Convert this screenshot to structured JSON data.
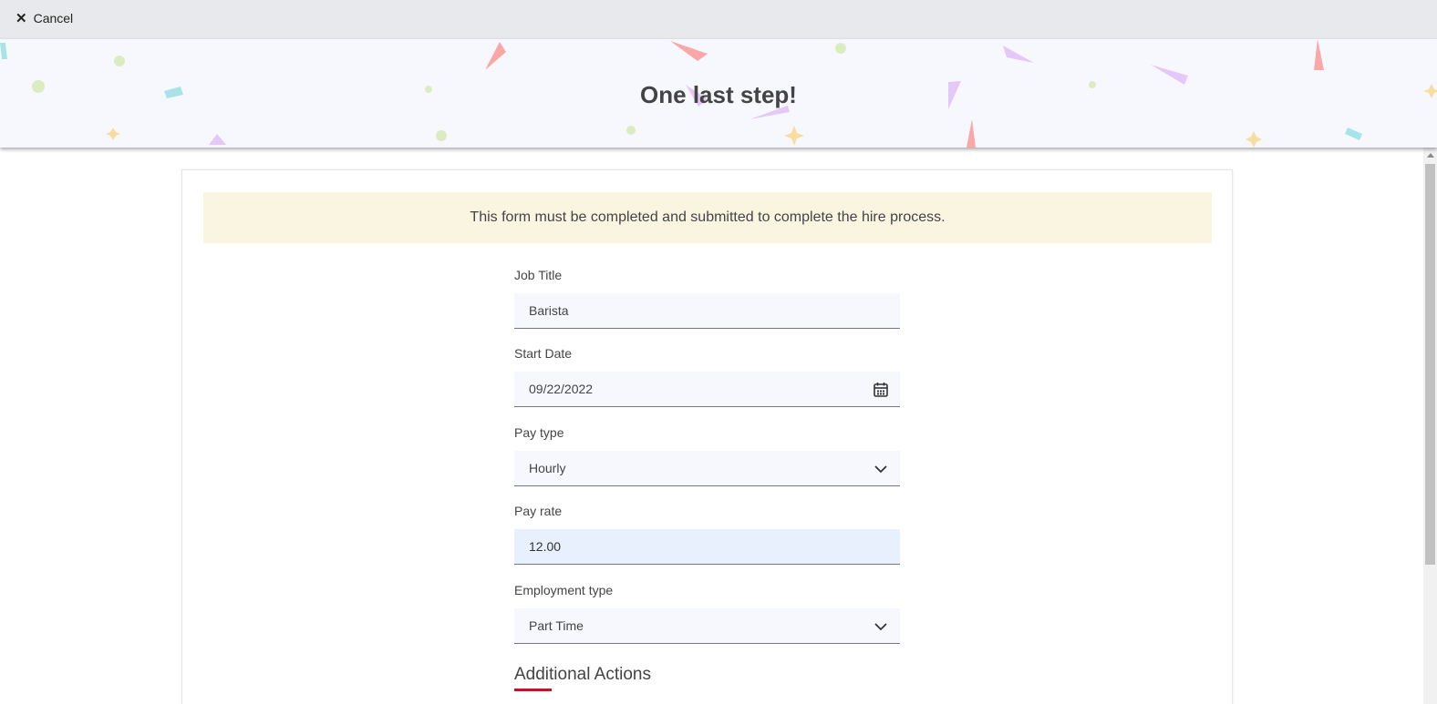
{
  "topbar": {
    "cancel_label": "Cancel",
    "cancel_icon": "close-icon"
  },
  "banner": {
    "title": "One last step!",
    "decoration": "confetti"
  },
  "notice": {
    "text": "This form must be completed and submitted to complete the hire process."
  },
  "form": {
    "job_title": {
      "label": "Job Title",
      "value": "Barista"
    },
    "start_date": {
      "label": "Start Date",
      "value": "09/22/2022",
      "icon": "calendar-icon"
    },
    "pay_type": {
      "label": "Pay type",
      "value": "Hourly",
      "icon": "chevron-down-icon"
    },
    "pay_rate": {
      "label": "Pay rate",
      "value": "12.00"
    },
    "employment_type": {
      "label": "Employment type",
      "value": "Part Time",
      "icon": "chevron-down-icon"
    }
  },
  "additional_actions": {
    "heading": "Additional Actions"
  },
  "colors": {
    "accent": "#c8102e",
    "banner_bg": "#f7f8fd",
    "notice_bg": "#faf5e1",
    "topbar_bg": "#e8e9ec",
    "active_field_bg": "#e8effd"
  }
}
